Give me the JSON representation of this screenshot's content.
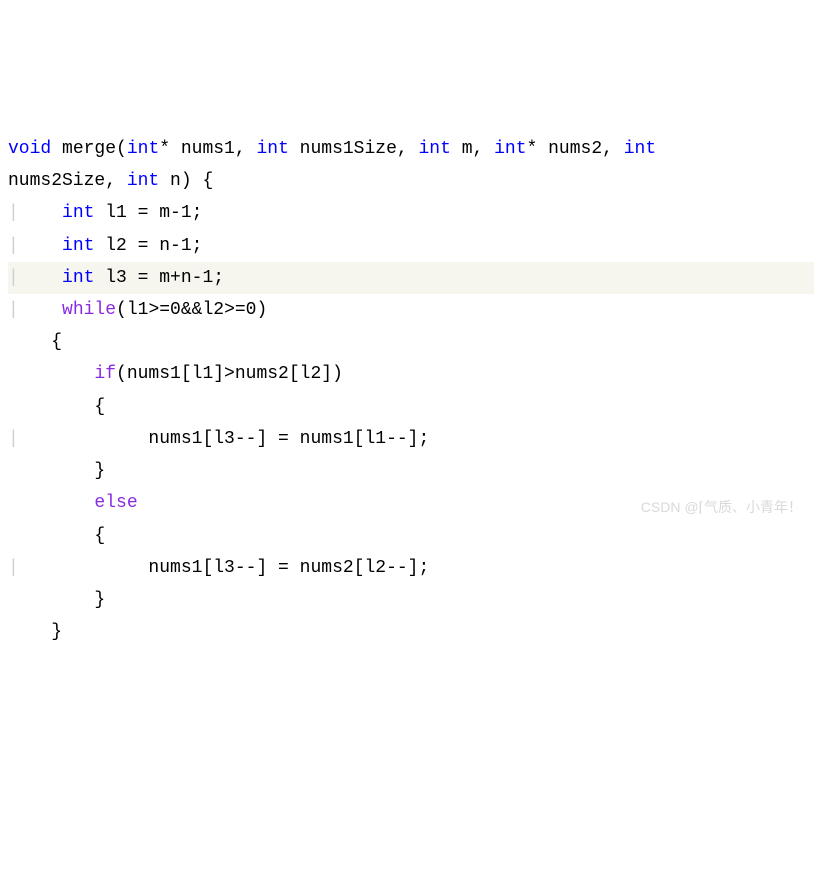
{
  "code": {
    "l1_kw1": "void",
    "l1_fn": " merge(",
    "l1_kw2": "int",
    "l1_p1": "* nums1, ",
    "l1_kw3": "int",
    "l1_p2": " nums1Size, ",
    "l1_kw4": "int",
    "l1_p3": " m, ",
    "l1_kw5": "int",
    "l1_p4": "* nums2, ",
    "l1_kw6": "int",
    "l2_p1": "nums2Size, ",
    "l2_kw1": "int",
    "l2_p2": " n) {",
    "l3_indent": "    ",
    "l3_kw": "int",
    "l3_rest": " l1 = m-1;",
    "l4_indent": "    ",
    "l4_kw": "int",
    "l4_rest": " l2 = n-1;",
    "l5_indent": "    ",
    "l5_kw": "int",
    "l5_rest": " l3 = m+n-1;",
    "l6_indent": "    ",
    "l6_kw": "while",
    "l6_rest": "(l1>=0&&l2>=0)",
    "l7": "    {",
    "l8_indent": "        ",
    "l8_kw": "if",
    "l8_rest": "(nums1[l1]>nums2[l2])",
    "l9": "        {",
    "l10": "            nums1[l3--] = nums1[l1--];",
    "l11": "        }",
    "l12_indent": "        ",
    "l12_kw": "else",
    "l13": "        {",
    "l14": "            nums1[l3--] = nums2[l2--];",
    "l15": "        }",
    "l16": "    }",
    "guide1": "|",
    "guide2": "|"
  },
  "watermark": "CSDN @⌈气质、小青年！"
}
